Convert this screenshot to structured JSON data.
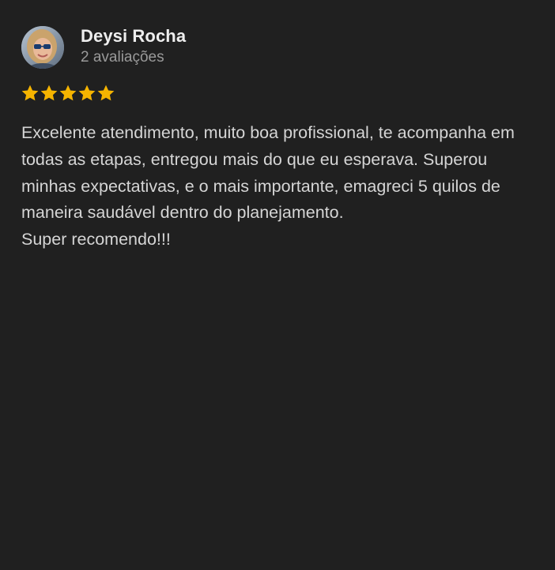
{
  "review": {
    "reviewer_name": "Deysi Rocha",
    "review_count": "2 avaliações",
    "rating": 5,
    "rating_max": 5,
    "star_color": "#f5b400",
    "text_paragraph_1": "Excelente atendimento, muito boa profissional, te acompanha em todas as etapas, entregou mais do que eu esperava. Superou minhas expectativas, e o mais importante, emagreci 5 quilos de maneira saudável dentro do planejamento.",
    "text_paragraph_2": "Super recomendo!!!"
  },
  "colors": {
    "background": "#202020",
    "name_text": "#eeeeee",
    "secondary_text": "#9a9a9a",
    "body_text": "#d5d5d5"
  },
  "icons": {
    "avatar": "avatar-photo",
    "star": "star-icon"
  }
}
